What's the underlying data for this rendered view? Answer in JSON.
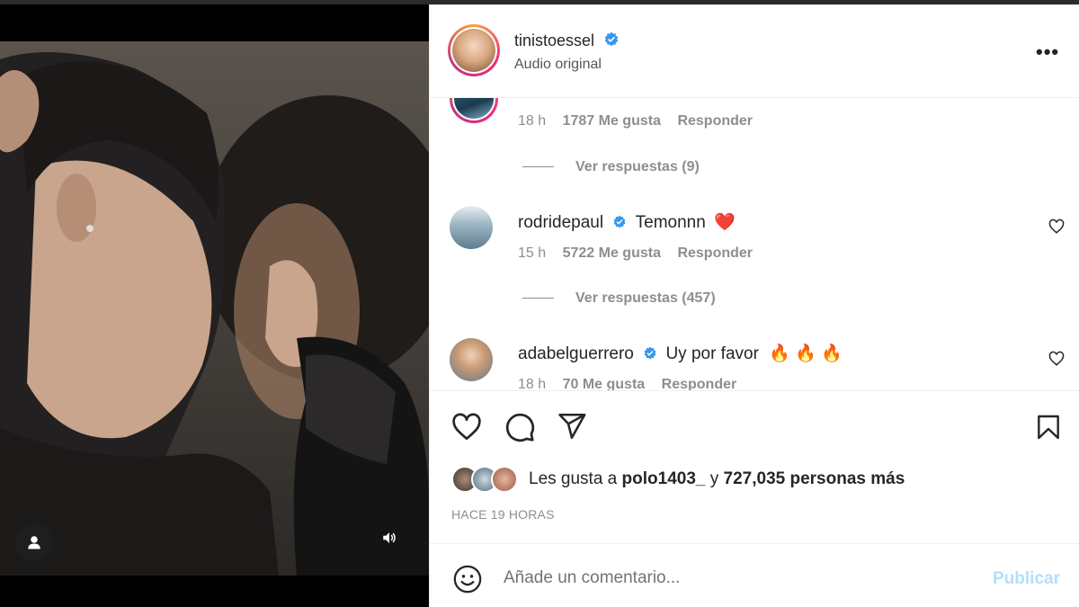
{
  "post": {
    "username": "tinistoessel",
    "subtitle": "Audio original",
    "more_label": "•••"
  },
  "comments": [
    {
      "user": "",
      "text": "",
      "time": "18 h",
      "likes": "1787 Me gusta",
      "reply_label": "Responder",
      "view_replies": "Ver respuestas (9)"
    },
    {
      "user": "rodridepaul",
      "verified": true,
      "text": "Temonnn",
      "emoji": "❤️",
      "time": "15 h",
      "likes": "5722 Me gusta",
      "reply_label": "Responder",
      "view_replies": "Ver respuestas (457)"
    },
    {
      "user": "adabelguerrero",
      "verified": true,
      "text": "Uy por favor",
      "emoji": "🔥 🔥 🔥",
      "time": "18 h",
      "likes": "70 Me gusta",
      "reply_label": "Responder"
    }
  ],
  "likes": {
    "prefix": "Les gusta a",
    "user": "polo1403_",
    "connector": "y",
    "count_text": "727,035 personas más"
  },
  "timestamp": "HACE 19 HORAS",
  "comment_box": {
    "placeholder": "Añade un comentario...",
    "publish_label": "Publicar"
  },
  "colors": {
    "verified": "#3897f0",
    "publish_disabled": "#b2dffc",
    "muted_text": "#8e8e8e"
  },
  "icons": [
    "heart-icon",
    "comment-icon",
    "share-icon",
    "bookmark-icon",
    "emoji-icon",
    "volume-icon",
    "user-icon",
    "more-icon"
  ]
}
